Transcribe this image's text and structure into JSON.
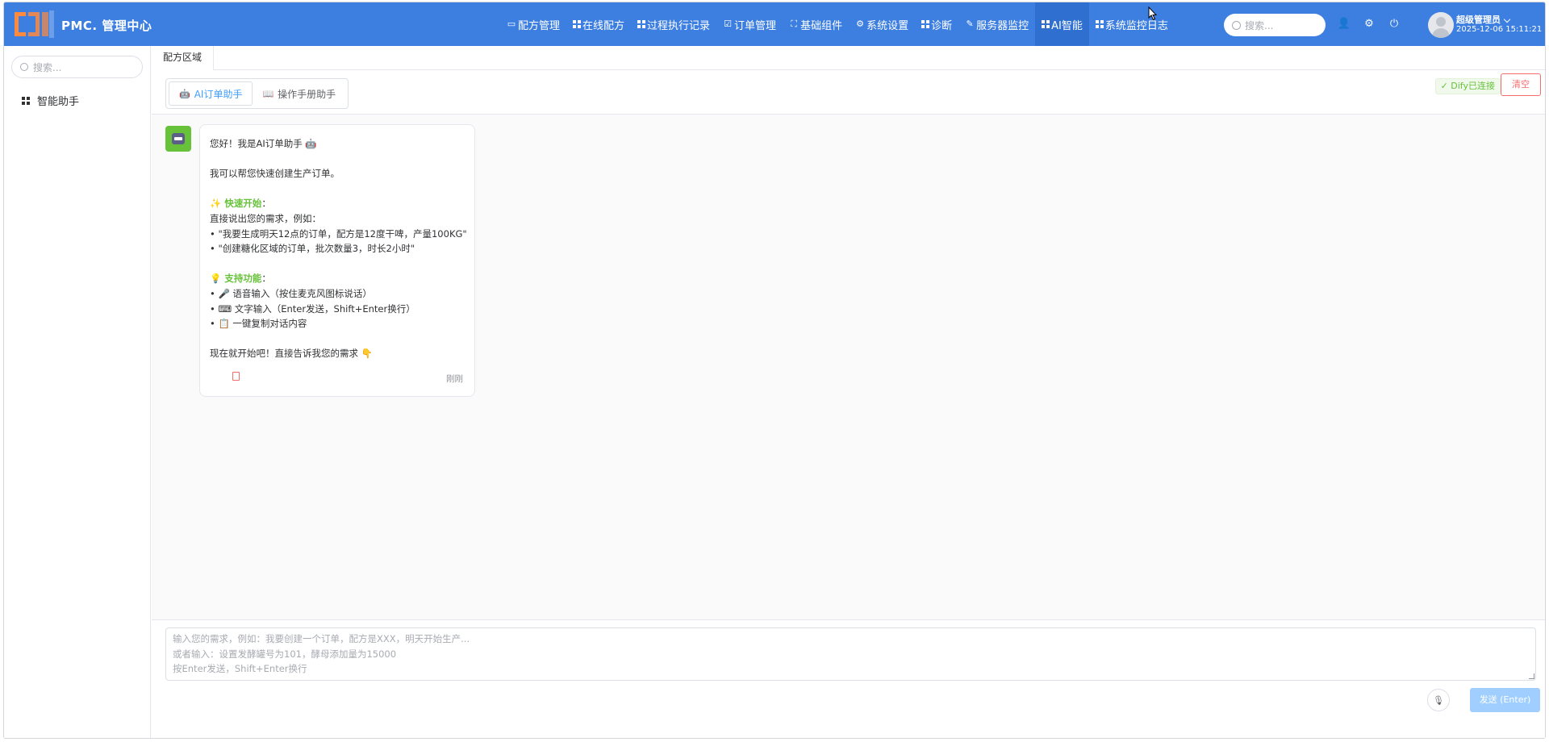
{
  "header": {
    "brand": "PMC. 管理中心",
    "nav": [
      {
        "label": "配方管理",
        "icon": "monitor-icon"
      },
      {
        "label": "在线配方",
        "icon": "grid-icon"
      },
      {
        "label": "过程执行记录",
        "icon": "grid-icon"
      },
      {
        "label": "订单管理",
        "icon": "checkbox-icon"
      },
      {
        "label": "基础组件",
        "icon": "expand-icon"
      },
      {
        "label": "系统设置",
        "icon": "gear-icon"
      },
      {
        "label": "诊断",
        "icon": "grid-icon"
      },
      {
        "label": "服务器监控",
        "icon": "link-icon"
      },
      {
        "label": "AI智能",
        "icon": "grid-icon",
        "active": true
      },
      {
        "label": "系统监控日志",
        "icon": "grid-icon"
      }
    ],
    "search_placeholder": "搜索...",
    "user_name": "超级管理员",
    "datetime": "2025-12-06 15:11:21"
  },
  "sidebar": {
    "search_placeholder": "搜索...",
    "items": [
      {
        "label": "智能助手"
      }
    ]
  },
  "main": {
    "tab": "配方区域",
    "modes": [
      {
        "label": "AI订单助手",
        "icon": "robot-icon",
        "active": true
      },
      {
        "label": "操作手册助手",
        "icon": "book-icon",
        "active": false
      }
    ],
    "status_badge": "✓ Dify已连接",
    "clear_label": "清空",
    "message": {
      "greeting": "您好！我是AI订单助手 🤖",
      "intro": "我可以帮您快速创建生产订单。",
      "quick_title": "✨ 快速开始",
      "quick_colon": "：",
      "quick_desc": "直接说出您的需求，例如：",
      "example1": "• \"我要生成明天12点的订单，配方是12度干啤，产量100KG\"",
      "example2": "• \"创建糖化区域的订单，批次数量3，时长2小时\"",
      "features_title": "💡 支持功能",
      "features_colon": "：",
      "feature1": "• 🎤 语音输入（按住麦克风图标说话）",
      "feature2": "• ⌨ 文字输入（Enter发送，Shift+Enter换行）",
      "feature3": "• 📋 一键复制对话内容",
      "closing": "现在就开始吧！直接告诉我您的需求 👇",
      "time": "刚刚"
    },
    "input": {
      "placeholder_line1": "输入您的需求，例如：我要创建一个订单，配方是XXX，明天开始生产...",
      "placeholder_line2": "或者输入：设置发酵罐号为101，酵母添加量为15000",
      "placeholder_line3": "按Enter发送，Shift+Enter换行"
    },
    "send_label": "发送 (Enter)"
  },
  "colors": {
    "header_bg": "#3d7fe0",
    "accent": "#409eff",
    "success": "#67c23a",
    "danger": "#f56c6c"
  }
}
